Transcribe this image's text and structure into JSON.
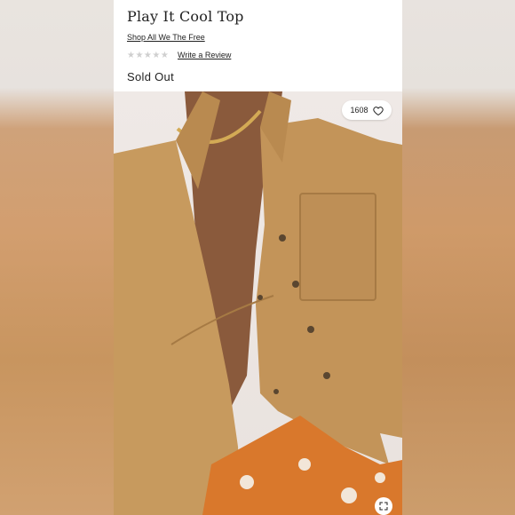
{
  "product": {
    "title": "Play It Cool Top",
    "shop_link": "Shop All We The Free",
    "rating_stars": "★★★★★",
    "review_link": "Write a Review",
    "status": "Sold Out"
  },
  "likes": {
    "count": "1608",
    "icon": "heart-icon"
  },
  "zoom": {
    "icon": "expand-icon"
  },
  "colors": {
    "shirt": "#c79a5e",
    "skin": "#8a5a3c",
    "pattern": "#d9782c"
  }
}
